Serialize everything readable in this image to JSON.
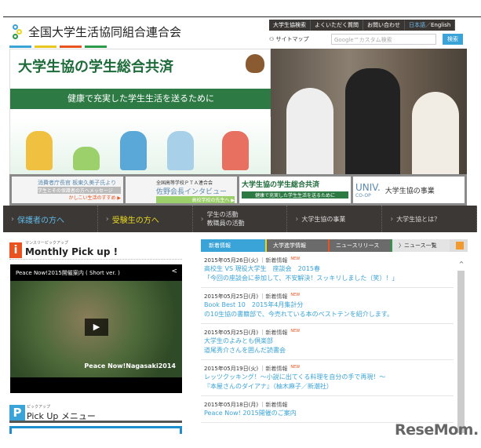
{
  "header": {
    "org_name": "全国大学生活協同組合連合会",
    "top_nav": [
      "大学生協検索",
      "よくいただく質問",
      "お問い合わせ"
    ],
    "lang_ja": "日本語",
    "lang_sep": "／",
    "lang_en": "English",
    "sitemap": "サイトマップ",
    "search_placeholder": "Google™カスタム検索",
    "search_button": "検索"
  },
  "hero": {
    "title": "大学生協の学生総合共済",
    "subtitle": "健康で充実した学生生活を送るために"
  },
  "banners": [
    {
      "line1": "消費者庁長官 板東久美子氏より",
      "line2": "学生とその保護者の方へメッセージ",
      "line3": "かしこい生活のすすめ ▶"
    },
    {
      "line1": "全国高等学校ＰＴＡ連合会",
      "line2": "佐野会長インタビュー",
      "line3": "高校学校の先生へ ▶"
    },
    {
      "line1": "大学生協の学生総合共済",
      "line2": "健康で充実した学生生活を送るために"
    },
    {
      "line1": "UNIV.",
      "line2": "CO-OP",
      "line3": "大学生協の事業"
    }
  ],
  "nav": [
    {
      "label": "保護者の方へ",
      "color": "#5fb8e6"
    },
    {
      "label": "受験生の方へ",
      "color": "#e8d820"
    },
    {
      "label": "学生の活動",
      "label2": "教職員の活動"
    },
    {
      "label": "大学生協の事業"
    },
    {
      "label": "大学生協とは？"
    }
  ],
  "monthly": {
    "small": "マンスリーピックアップ",
    "title": "Monthly Pick up !",
    "icon": "i",
    "video_title": "Peace Now!2015開催案内 ( Short ver. )",
    "video_caption": "Peace Now!Nagasaki2014"
  },
  "pickup": {
    "small": "ピックアップ",
    "title": "Pick Up メニュー",
    "icon": "P"
  },
  "tabs": [
    {
      "label": "新着情報",
      "color": "#3aa3d8"
    },
    {
      "label": "大学進学情報",
      "color": "#e8d820"
    },
    {
      "label": "ニュースリリース",
      "color": "#e8531f"
    },
    {
      "label": "〉ニュース一覧",
      "color": "#2d9a4a"
    }
  ],
  "news": [
    {
      "date": "2015年05月26日(火)",
      "cat": "｜新着情報",
      "new": "NEW",
      "lines": [
        "高校生 VS 現役大学生　座談会　2015春",
        "「今回の座談会に参加して、不安解決！スッキリしました（笑）！」"
      ]
    },
    {
      "date": "2015年05月25日(月)",
      "cat": "｜新着情報",
      "new": "NEW",
      "lines": [
        "Book Best 10　2015年4月集計分",
        "の10生協の書籍部で、今売れている本のベストテンを紹介します。"
      ]
    },
    {
      "date": "2015年05月25日(月)",
      "cat": "｜新着情報",
      "new": "NEW",
      "lines": [
        "大学生のよみとも倶楽部",
        "道尾秀介さんを囲んだ読書会"
      ]
    },
    {
      "date": "2015年05月19日(火)",
      "cat": "｜新着情報",
      "new": "NEW",
      "lines": [
        "レッツクッキング！～小説に出てくる料理を自分の手で再現！～",
        "『本屋さんのダイアナ』（柚木麻子／新潮社）"
      ]
    },
    {
      "date": "2015年05月18日(月)",
      "cat": "｜新着情報",
      "new": "",
      "lines": [
        "Peace Now! 2015開催のご案内"
      ]
    }
  ],
  "watermark": "ReseMom."
}
